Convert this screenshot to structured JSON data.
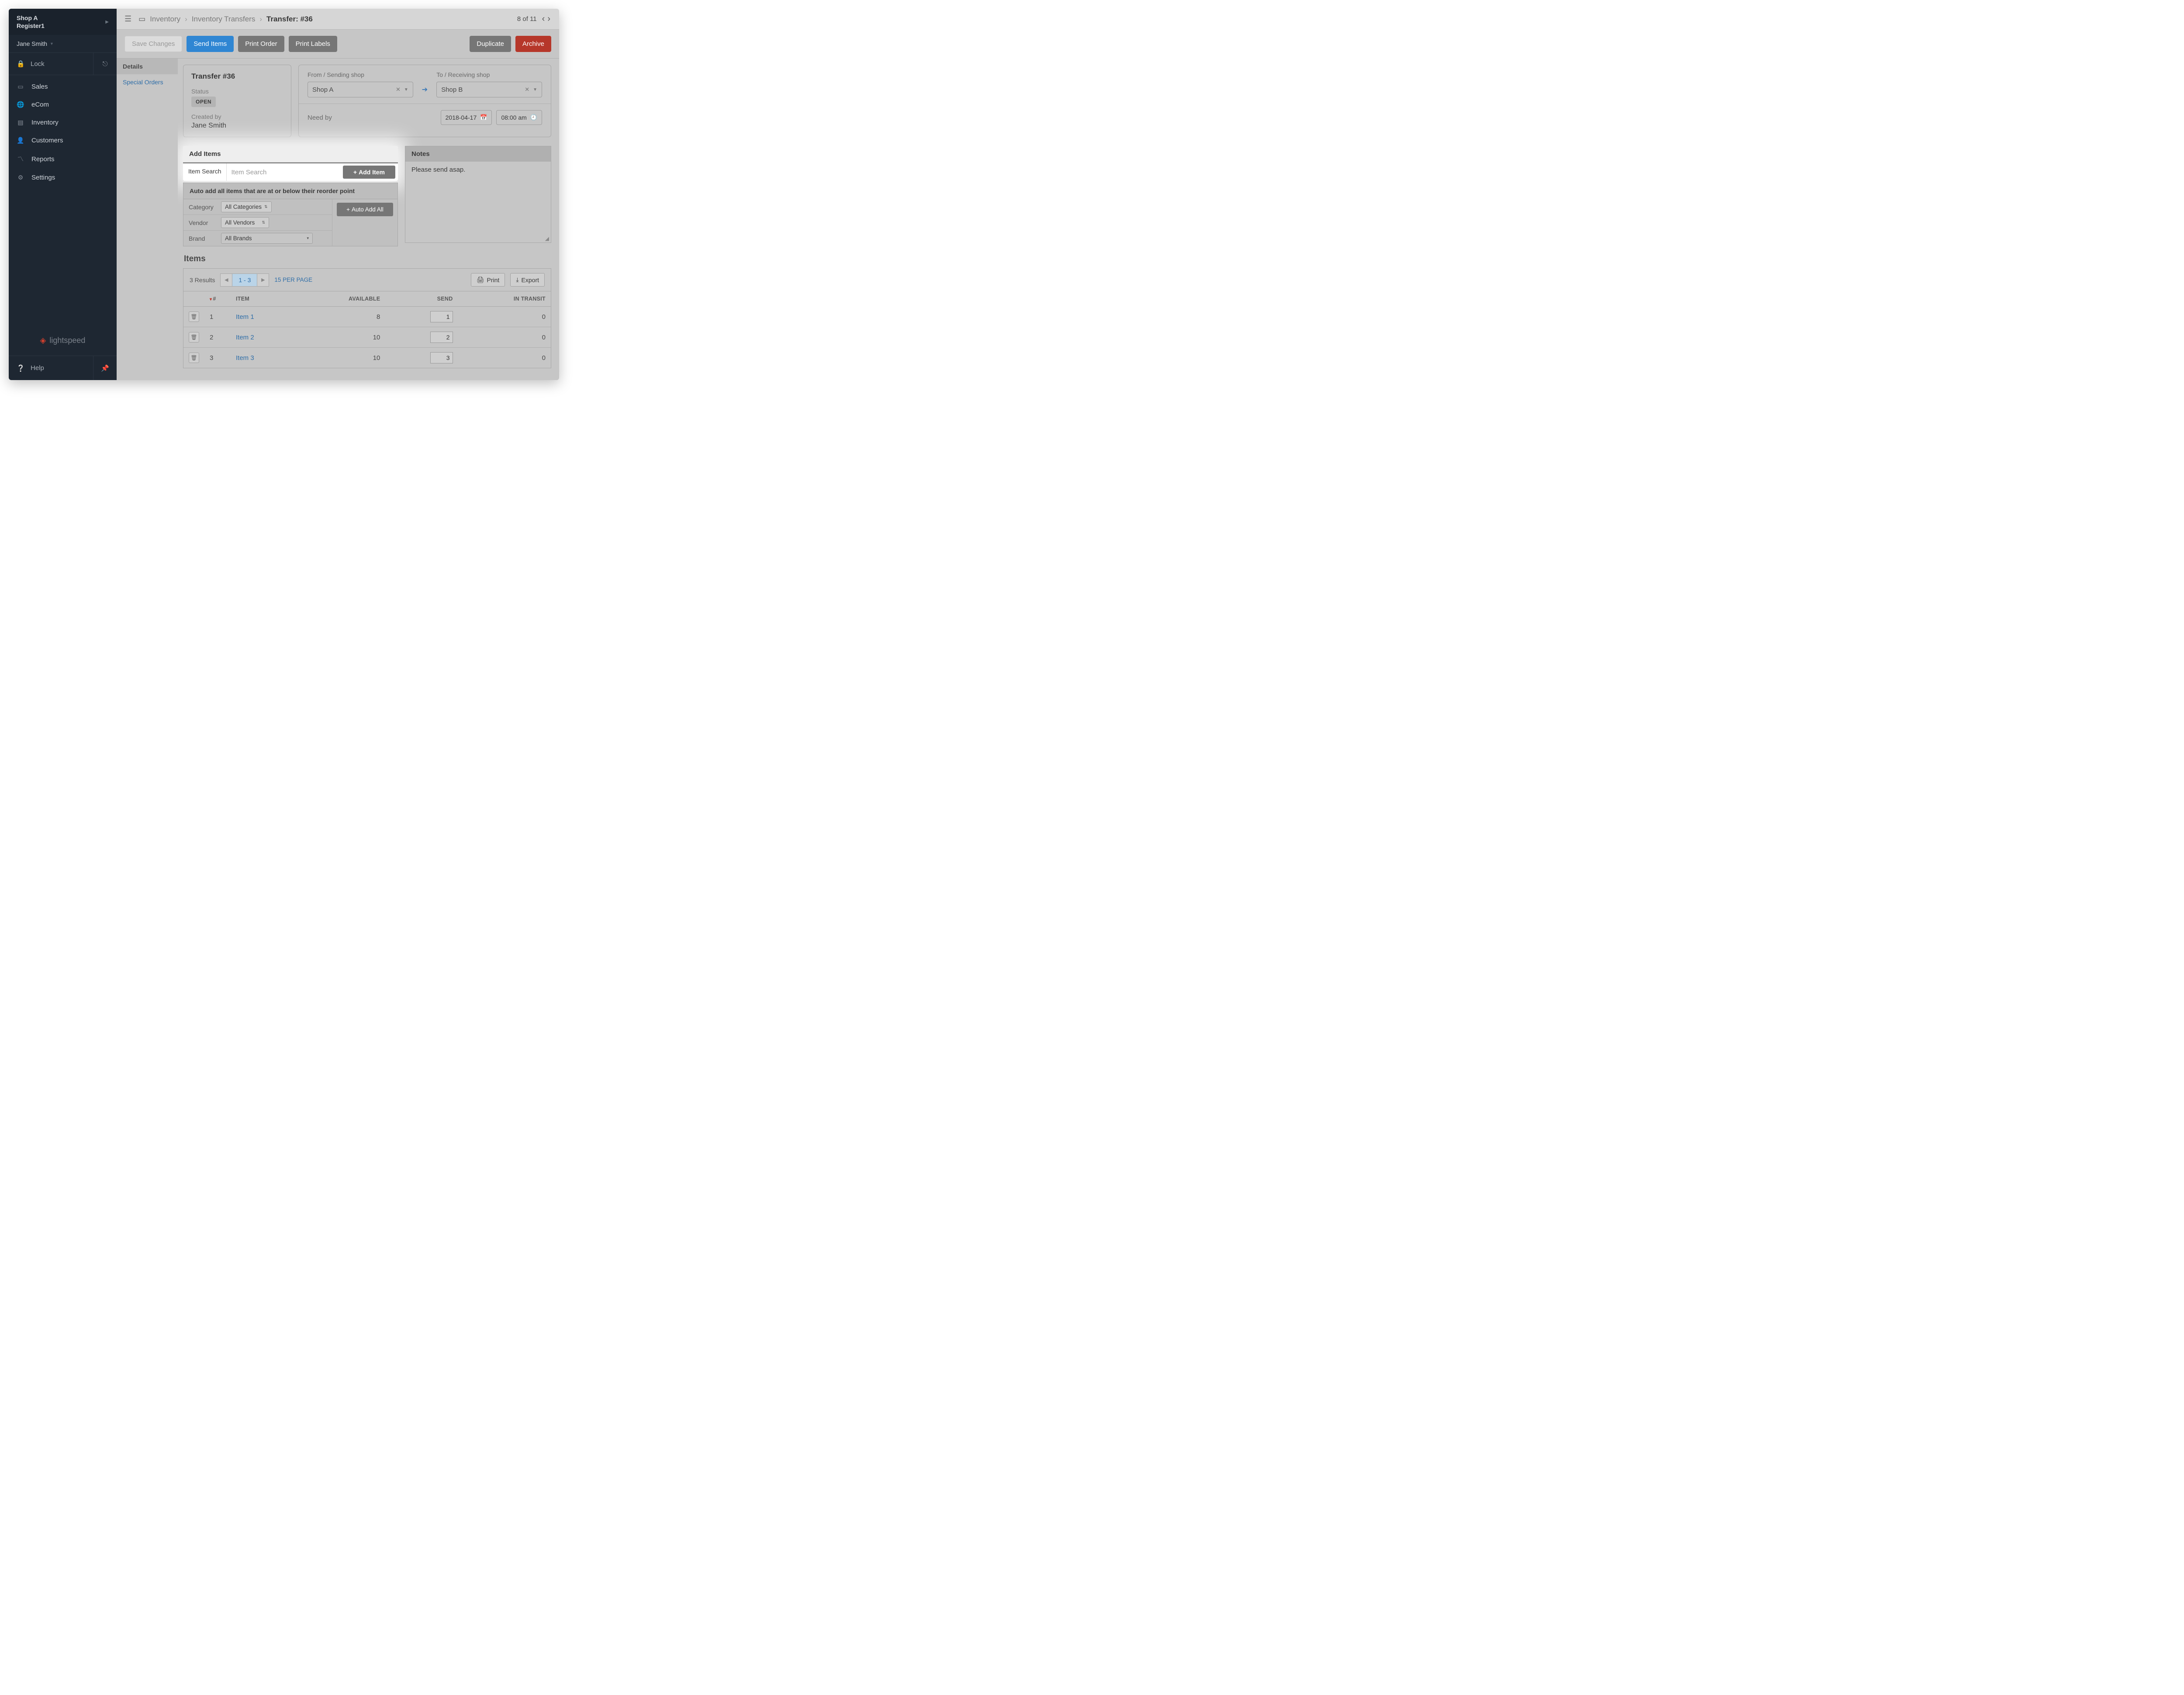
{
  "sidebar": {
    "shop_name": "Shop A",
    "register_name": "Register1",
    "user_name": "Jane Smith",
    "lock_label": "Lock",
    "nav": [
      {
        "icon": "sales",
        "label": "Sales"
      },
      {
        "icon": "ecom",
        "label": "eCom"
      },
      {
        "icon": "inventory",
        "label": "Inventory"
      },
      {
        "icon": "customers",
        "label": "Customers"
      },
      {
        "icon": "reports",
        "label": "Reports"
      },
      {
        "icon": "settings",
        "label": "Settings"
      }
    ],
    "logo_text": "lightspeed",
    "help_label": "Help"
  },
  "breadcrumb": {
    "level1": "Inventory",
    "level2": "Inventory Transfers",
    "current": "Transfer: #36"
  },
  "pager_top": {
    "position": "8 of 11"
  },
  "actions": {
    "save": "Save Changes",
    "send": "Send Items",
    "print_order": "Print Order",
    "print_labels": "Print Labels",
    "duplicate": "Duplicate",
    "archive": "Archive"
  },
  "left_tabs": {
    "details": "Details",
    "special_orders": "Special Orders"
  },
  "transfer_card": {
    "title": "Transfer #36",
    "status_label": "Status",
    "status_value": "OPEN",
    "created_by_label": "Created by",
    "created_by_value": "Jane Smith"
  },
  "shops_card": {
    "from_label": "From / Sending shop",
    "to_label": "To / Receiving shop",
    "from_value": "Shop A",
    "to_value": "Shop B",
    "need_by_label": "Need by",
    "need_by_date": "2018-04-17",
    "need_by_time": "08:00 am"
  },
  "add_items": {
    "heading": "Add Items",
    "search_label": "Item Search",
    "search_placeholder": "Item Search",
    "add_item_btn": "Add Item"
  },
  "auto_add": {
    "heading": "Auto add all items that are at or below their reorder point",
    "category_label": "Category",
    "vendor_label": "Vendor",
    "brand_label": "Brand",
    "category_value": "All Categories",
    "vendor_value": "All Vendors",
    "brand_value": "All Brands",
    "auto_btn": "Auto Add All"
  },
  "notes": {
    "heading": "Notes",
    "content": "Please send asap."
  },
  "items_section": {
    "title": "Items",
    "results": "3 Results",
    "page_display": "1 - 3",
    "per_page": "15 PER PAGE",
    "print_btn": "Print",
    "export_btn": "Export",
    "headers": {
      "num": "#",
      "item": "ITEM",
      "available": "AVAILABLE",
      "send": "SEND",
      "in_transit": "IN TRANSIT"
    },
    "rows": [
      {
        "num": "1",
        "item": "Item 1",
        "available": "8",
        "send": "1",
        "in_transit": "0"
      },
      {
        "num": "2",
        "item": "Item 2",
        "available": "10",
        "send": "2",
        "in_transit": "0"
      },
      {
        "num": "3",
        "item": "Item 3",
        "available": "10",
        "send": "3",
        "in_transit": "0"
      }
    ]
  }
}
